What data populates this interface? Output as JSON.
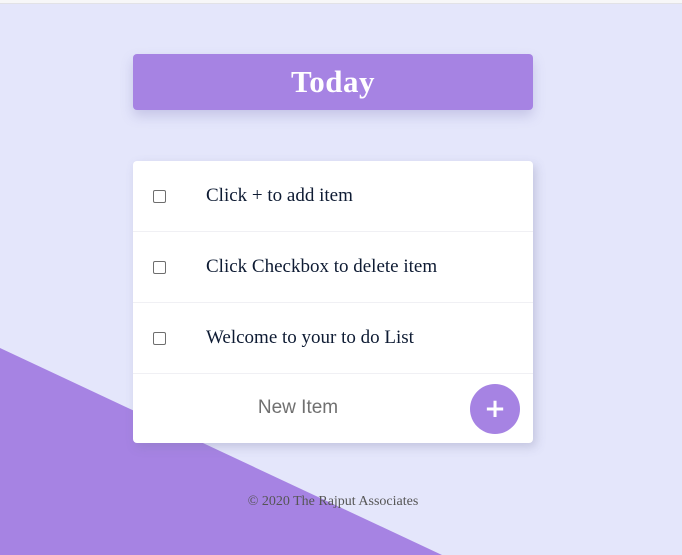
{
  "colors": {
    "background": "#e4e6fb",
    "accent": "#a683e3",
    "card": "#ffffff",
    "item_text": "#0e1b33"
  },
  "heading": {
    "title": "Today"
  },
  "todo": {
    "items": [
      {
        "label": "Click + to add item",
        "checked": false
      },
      {
        "label": "Click Checkbox to delete item",
        "checked": false
      },
      {
        "label": "Welcome to your to do List",
        "checked": false
      }
    ]
  },
  "new_item": {
    "placeholder": "New Item",
    "value": "",
    "add_label": "+",
    "add_icon": "plus-icon"
  },
  "footer": {
    "copyright": "© 2020 The Rajput Associates"
  }
}
